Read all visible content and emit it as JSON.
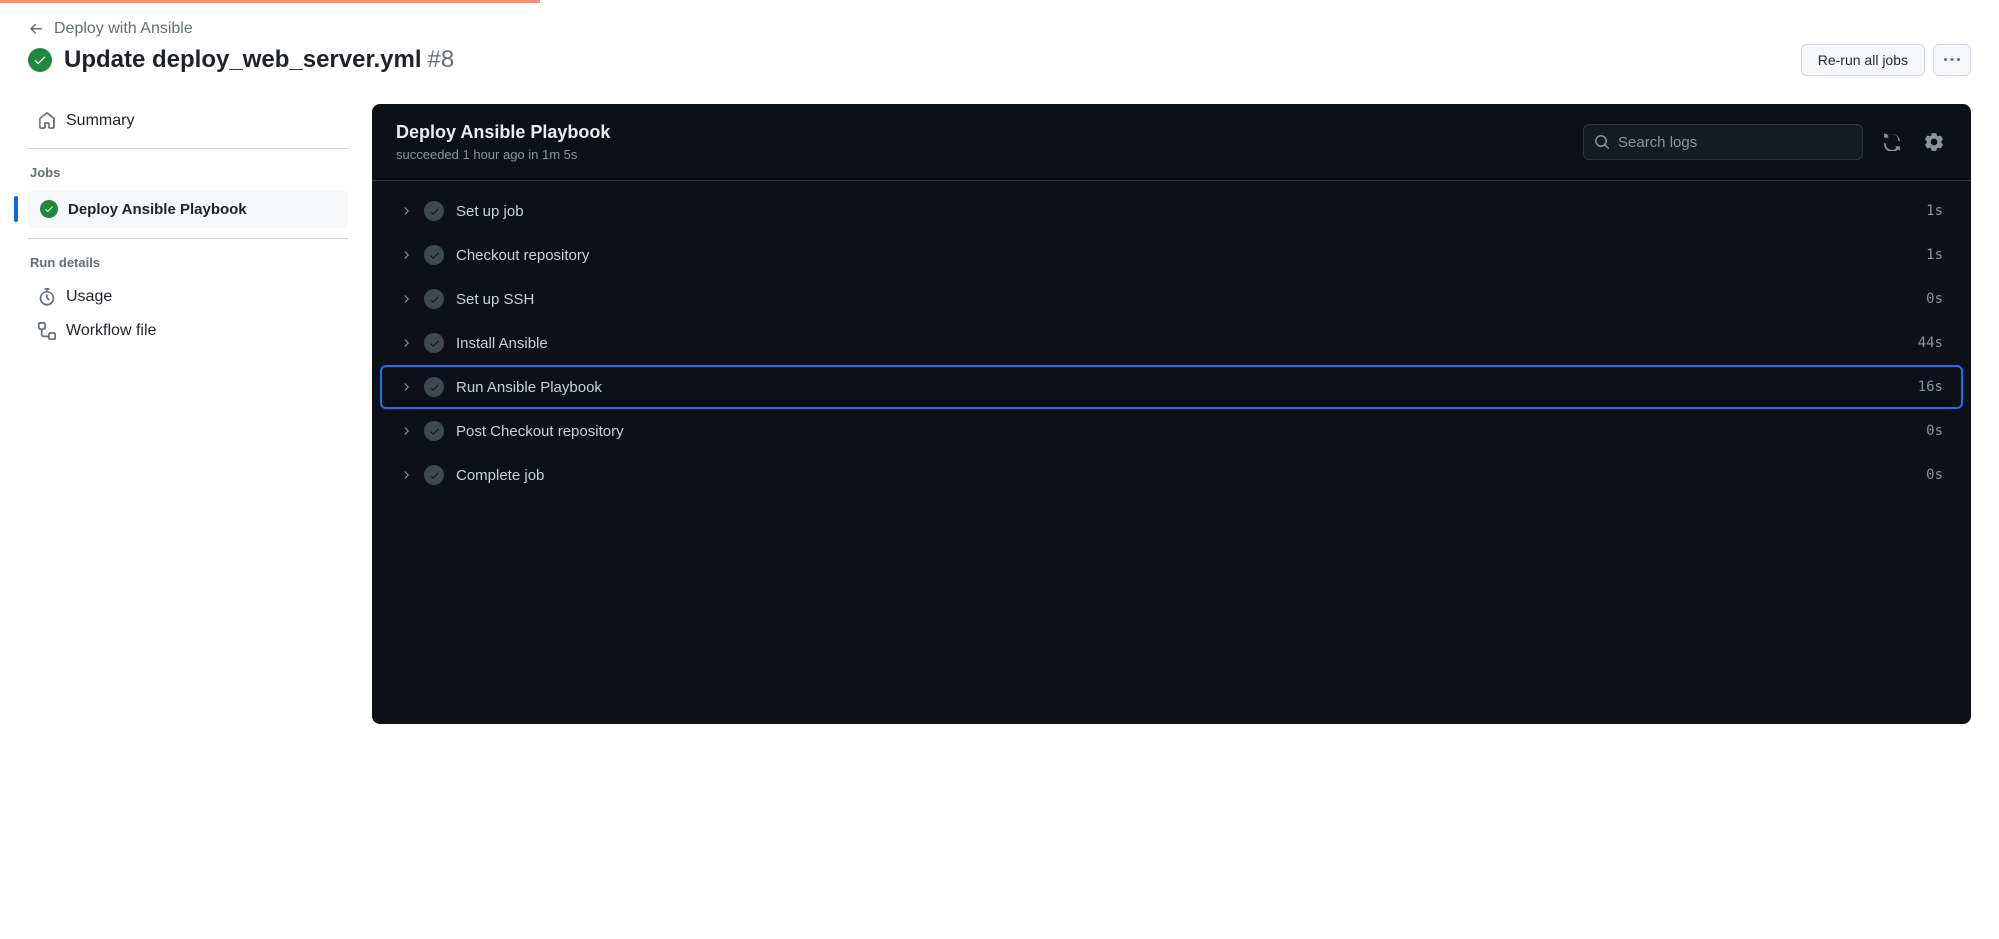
{
  "breadcrumb": {
    "label": "Deploy with Ansible"
  },
  "run": {
    "title": "Update deploy_web_server.yml",
    "number": "#8"
  },
  "actions": {
    "rerun_label": "Re-run all jobs"
  },
  "sidebar": {
    "summary_label": "Summary",
    "jobs_label": "Jobs",
    "run_details_label": "Run details",
    "usage_label": "Usage",
    "workflow_file_label": "Workflow file",
    "job_0_label": "Deploy Ansible Playbook"
  },
  "log": {
    "title": "Deploy Ansible Playbook",
    "subtitle": "succeeded 1 hour ago in 1m 5s",
    "search_placeholder": "Search logs"
  },
  "steps": [
    {
      "name": "Set up job",
      "time": "1s",
      "selected": false
    },
    {
      "name": "Checkout repository",
      "time": "1s",
      "selected": false
    },
    {
      "name": "Set up SSH",
      "time": "0s",
      "selected": false
    },
    {
      "name": "Install Ansible",
      "time": "44s",
      "selected": false
    },
    {
      "name": "Run Ansible Playbook",
      "time": "16s",
      "selected": true
    },
    {
      "name": "Post Checkout repository",
      "time": "0s",
      "selected": false
    },
    {
      "name": "Complete job",
      "time": "0s",
      "selected": false
    }
  ]
}
